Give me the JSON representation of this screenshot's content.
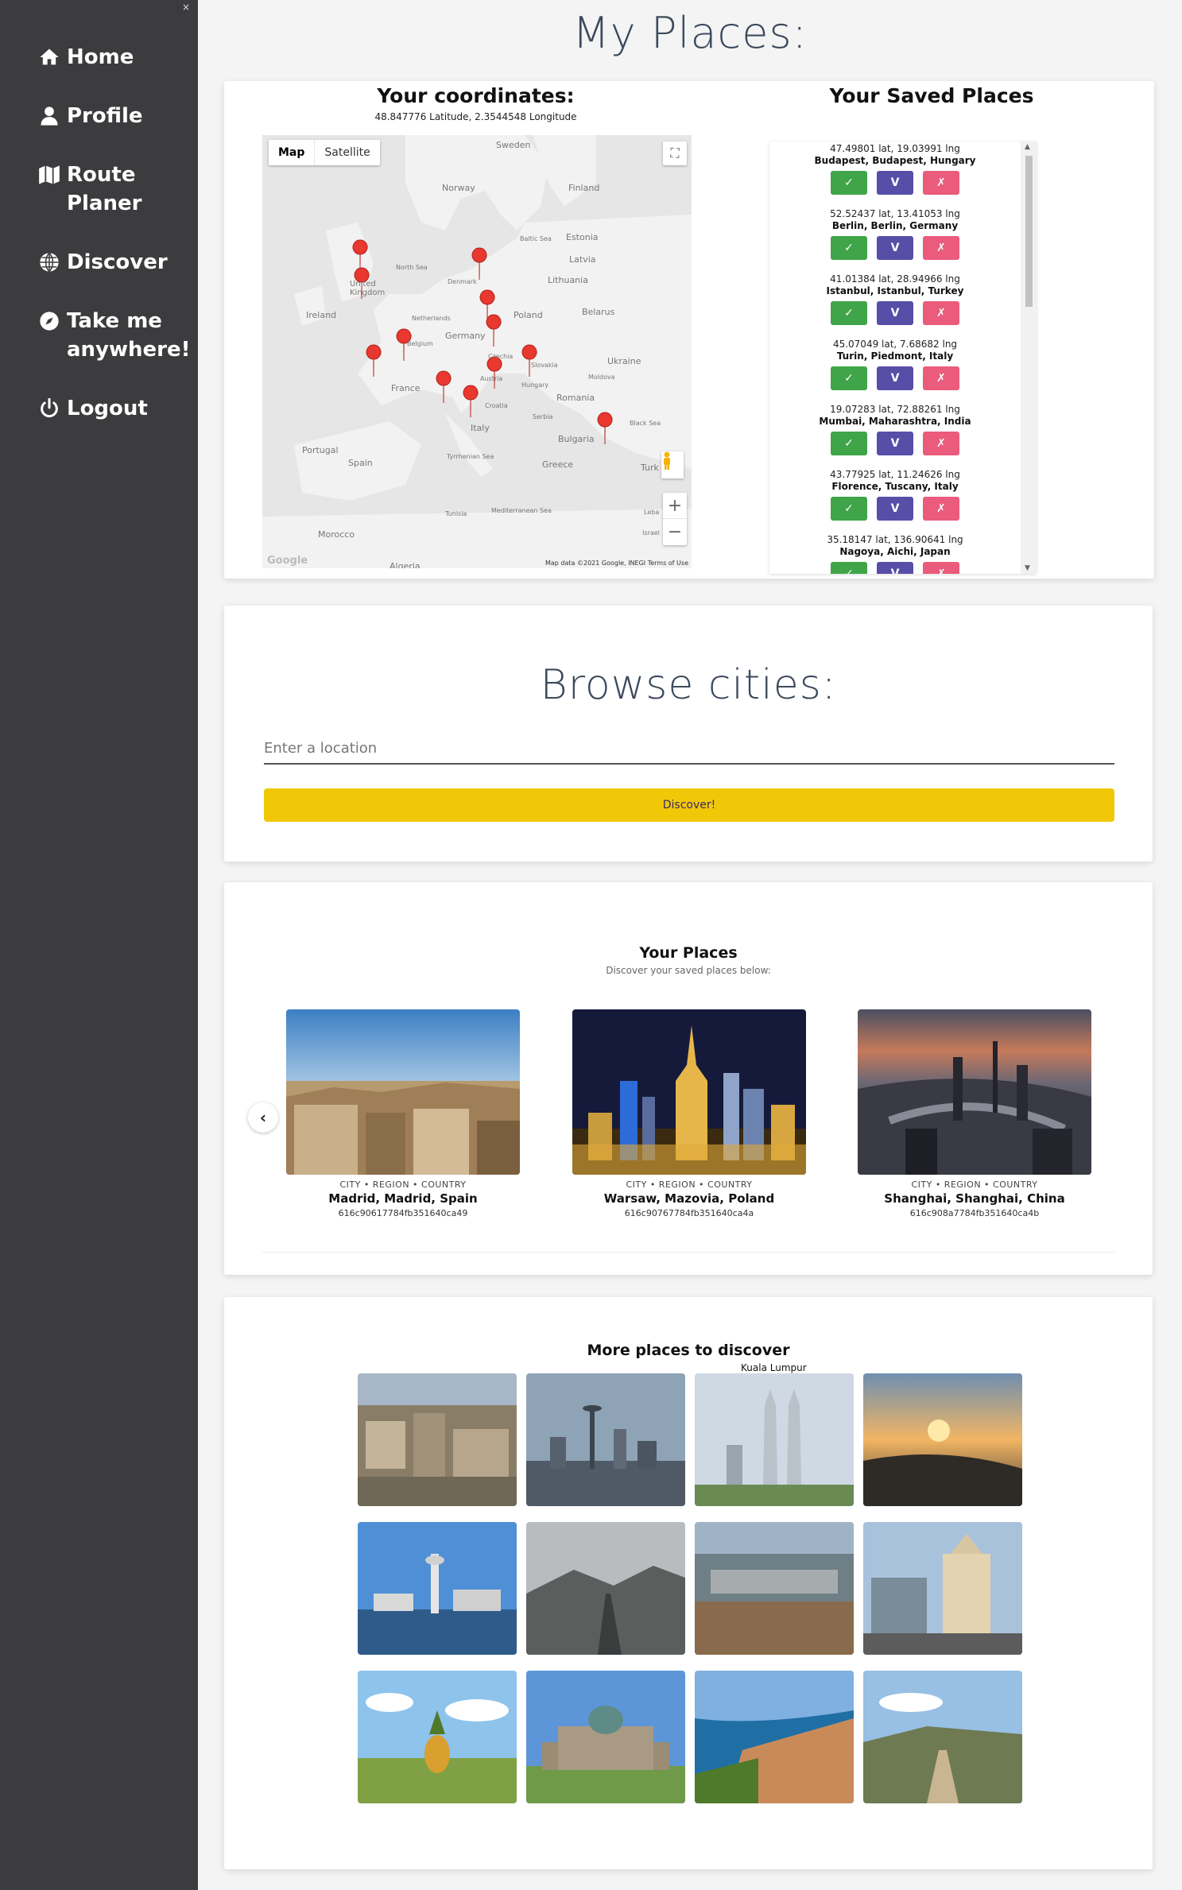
{
  "sidebar": {
    "close_label": "×",
    "items": [
      {
        "label": "Home",
        "icon": "home-icon"
      },
      {
        "label": "Profile",
        "icon": "user-icon"
      },
      {
        "label": "Route\nPlaner",
        "icon": "map-icon"
      },
      {
        "label": "Discover",
        "icon": "globe-icon"
      },
      {
        "label": "Take me\nanywhere!",
        "icon": "compass-icon"
      },
      {
        "label": "Logout",
        "icon": "power-icon"
      }
    ]
  },
  "page_title": "My Places:",
  "coordinates": {
    "title": "Your coordinates:",
    "value": "48.847776 Latitude, 2.3544548 Longitude"
  },
  "map": {
    "map_label": "Map",
    "satellite_label": "Satellite",
    "attribution": "Map data ©2021 Google, INEGI   Terms of Use",
    "google": "Google",
    "labels": {
      "sweden": "Sweden",
      "finland": "Finland",
      "norway": "Norway",
      "estonia": "Estonia",
      "baltic": "Baltic Sea",
      "latvia": "Latvia",
      "northsea": "North Sea",
      "denmark": "Denmark",
      "lithuania": "Lithuania",
      "ireland": "Ireland",
      "uk": "United Kingdom",
      "netherlands": "Netherlands",
      "poland": "Poland",
      "belarus": "Belarus",
      "germany": "Germany",
      "belgium": "Belgium",
      "czechia": "Czechia",
      "slovakia": "Slovakia",
      "ukraine": "Ukraine",
      "france": "France",
      "austria": "Austria",
      "hungary": "Hungary",
      "moldova": "Moldova",
      "romania": "Romania",
      "croatia": "Croatia",
      "serbia": "Serbia",
      "italy": "Italy",
      "blacksea": "Black Sea",
      "bulgaria": "Bulgaria",
      "portugal": "Portugal",
      "spain": "Spain",
      "tyrrhenian": "Tyrrhenian Sea",
      "greece": "Greece",
      "turkey": "Turk",
      "tunisia": "Tunisia",
      "med": "Mediterranean Sea",
      "lebanon": "Leba",
      "israel": "Israel",
      "morocco": "Morocco",
      "algeria": "Algeria"
    }
  },
  "saved": {
    "title": "Your Saved Places",
    "btn_ok": "✓",
    "btn_view": "V",
    "btn_del": "✗",
    "items": [
      {
        "coords": "47.49801 lat, 19.03991 lng",
        "name": "Budapest, Budapest, Hungary"
      },
      {
        "coords": "52.52437 lat, 13.41053 lng",
        "name": "Berlin, Berlin, Germany"
      },
      {
        "coords": "41.01384 lat, 28.94966 lng",
        "name": "Istanbul, Istanbul, Turkey"
      },
      {
        "coords": "45.07049 lat, 7.68682 lng",
        "name": "Turin, Piedmont, Italy"
      },
      {
        "coords": "19.07283 lat, 72.88261 lng",
        "name": "Mumbai, Maharashtra, India"
      },
      {
        "coords": "43.77925 lat, 11.24626 lng",
        "name": "Florence, Tuscany, Italy"
      },
      {
        "coords": "35.18147 lat, 136.90641 lng",
        "name": "Nagoya, Aichi, Japan"
      }
    ]
  },
  "browse": {
    "title": "Browse cities:",
    "placeholder": "Enter a location",
    "button": "Discover!"
  },
  "your_places": {
    "title": "Your Places",
    "subtitle": "Discover your saved places below:",
    "prev": "‹",
    "slides": [
      {
        "tag": "CITY • REGION • COUNTRY",
        "name": "Madrid, Madrid, Spain",
        "id": "616c90617784fb351640ca49"
      },
      {
        "tag": "CITY • REGION • COUNTRY",
        "name": "Warsaw, Mazovia, Poland",
        "id": "616c90767784fb351640ca4a"
      },
      {
        "tag": "CITY • REGION • COUNTRY",
        "name": "Shanghai, Shanghai, China",
        "id": "616c908a7784fb351640ca4b"
      }
    ]
  },
  "more": {
    "title": "More places to discover",
    "caption": "Kuala Lumpur"
  },
  "colors": {
    "sidebar": "#3c3c3e",
    "accent_yellow": "#f0c808",
    "ok_green": "#3fa548",
    "view_purple": "#574ea8",
    "delete_pink": "#ea5b7c",
    "marker_red": "#e8382f"
  }
}
